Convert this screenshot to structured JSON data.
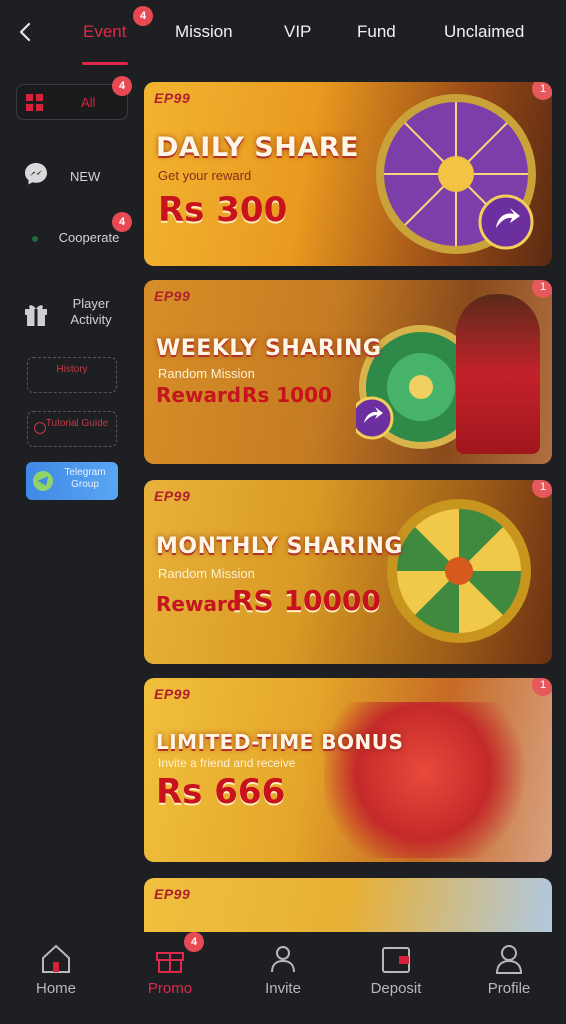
{
  "header": {
    "back_icon": "chevron-left-icon",
    "tabs": [
      {
        "label": "Event",
        "badge": "4",
        "active": true
      },
      {
        "label": "Mission"
      },
      {
        "label": "VIP"
      },
      {
        "label": "Fund"
      },
      {
        "label": "Unclaimed"
      }
    ]
  },
  "sidebar": {
    "items": [
      {
        "label": "All",
        "icon": "grid-icon",
        "badge": "4"
      },
      {
        "label": "NEW",
        "icon": "messenger-icon"
      },
      {
        "label": "Cooperate",
        "icon": "handshake-icon",
        "badge": "4"
      },
      {
        "label": "Player Activity",
        "icon": "gift-icon"
      }
    ],
    "buttons": [
      {
        "label": "History"
      },
      {
        "label": "Tutorial Guide"
      }
    ],
    "telegram": {
      "label": "Telegram Group",
      "icon": "telegram-icon"
    }
  },
  "banners": [
    {
      "brand": "EP99",
      "title": "DAILY SHARE",
      "subtitle": "Get your reward",
      "reward_label": "",
      "amount": "Rs 300",
      "badge": "1"
    },
    {
      "brand": "EP99",
      "title": "WEEKLY SHARING",
      "subtitle": "Random Mission",
      "reward_label": "Reward",
      "amount": "Rs 1000",
      "badge": "1"
    },
    {
      "brand": "EP99",
      "title": "MONTHLY SHARING",
      "subtitle": "Random Mission",
      "reward_label": "Reward",
      "amount": "RS 10000",
      "badge": "1"
    },
    {
      "brand": "EP99",
      "title": "LIMITED-TIME BONUS",
      "subtitle": "Invite a friend and receive",
      "reward_label": "",
      "amount": "Rs 666",
      "badge": "1"
    },
    {
      "brand": "EP99"
    }
  ],
  "bottom_nav": [
    {
      "label": "Home",
      "icon": "home-icon"
    },
    {
      "label": "Promo",
      "icon": "gift-box-icon",
      "badge": "4",
      "active": true
    },
    {
      "label": "Invite",
      "icon": "users-icon"
    },
    {
      "label": "Deposit",
      "icon": "wallet-icon"
    },
    {
      "label": "Profile",
      "icon": "user-icon"
    }
  ],
  "colors": {
    "background": "#1e1f22",
    "accent": "#e0294a",
    "badge": "#e84a54",
    "banner_gold": "#e8b23a"
  }
}
